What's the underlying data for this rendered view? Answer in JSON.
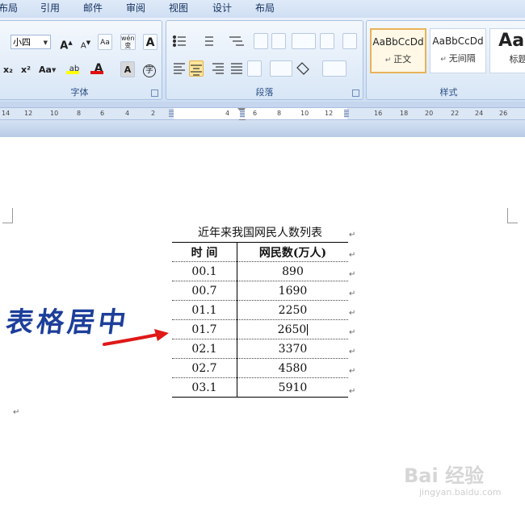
{
  "tabs": [
    "布局",
    "引用",
    "邮件",
    "审阅",
    "视图",
    "设计",
    "布局"
  ],
  "font_group": {
    "label": "字体",
    "font_size": "小四",
    "grow_label": "A",
    "shrink_label": "A",
    "clear_label": "Aa",
    "phonetic_label": "wén",
    "char_border_label": "A",
    "subscript_label": "x₂",
    "superscript_label": "x²",
    "case_label": "Aa",
    "highlight_label": "ab",
    "font_color_label": "A",
    "shading_label": "A",
    "enclose_label": "字",
    "highlight_color": "#ffff00",
    "font_color": "#e01010"
  },
  "para_group": {
    "label": "段落"
  },
  "styles_group": {
    "label": "样式",
    "items": [
      {
        "sample": "AaBbCcDd",
        "name": "正文"
      },
      {
        "sample": "AaBbCcDd",
        "name": "无间隔"
      },
      {
        "sample": "AaB",
        "name": "标题"
      }
    ]
  },
  "ruler": {
    "numbers": [
      "14",
      "12",
      "10",
      "8",
      "6",
      "4",
      "2",
      "4",
      "6",
      "8",
      "10",
      "12",
      "16",
      "18",
      "20",
      "22",
      "24",
      "26"
    ]
  },
  "table": {
    "caption": "近年来我国网民人数列表",
    "headers": [
      "时 间",
      "网民数(万人)"
    ],
    "rows": [
      {
        "time": "00.1",
        "value": "890"
      },
      {
        "time": "00.7",
        "value": "1690"
      },
      {
        "time": "01.1",
        "value": "2250"
      },
      {
        "time": "01.7",
        "value": "2650"
      },
      {
        "time": "02.1",
        "value": "3370"
      },
      {
        "time": "02.7",
        "value": "4580"
      },
      {
        "time": "03.1",
        "value": "5910"
      }
    ]
  },
  "annotation": {
    "text": "表格居中",
    "color": "#1d3f9a",
    "arrow_color": "#e01818"
  },
  "paragraph_mark": "↵",
  "watermark": {
    "brand": "Bai 经验",
    "url": "jingyan.baidu.com"
  }
}
